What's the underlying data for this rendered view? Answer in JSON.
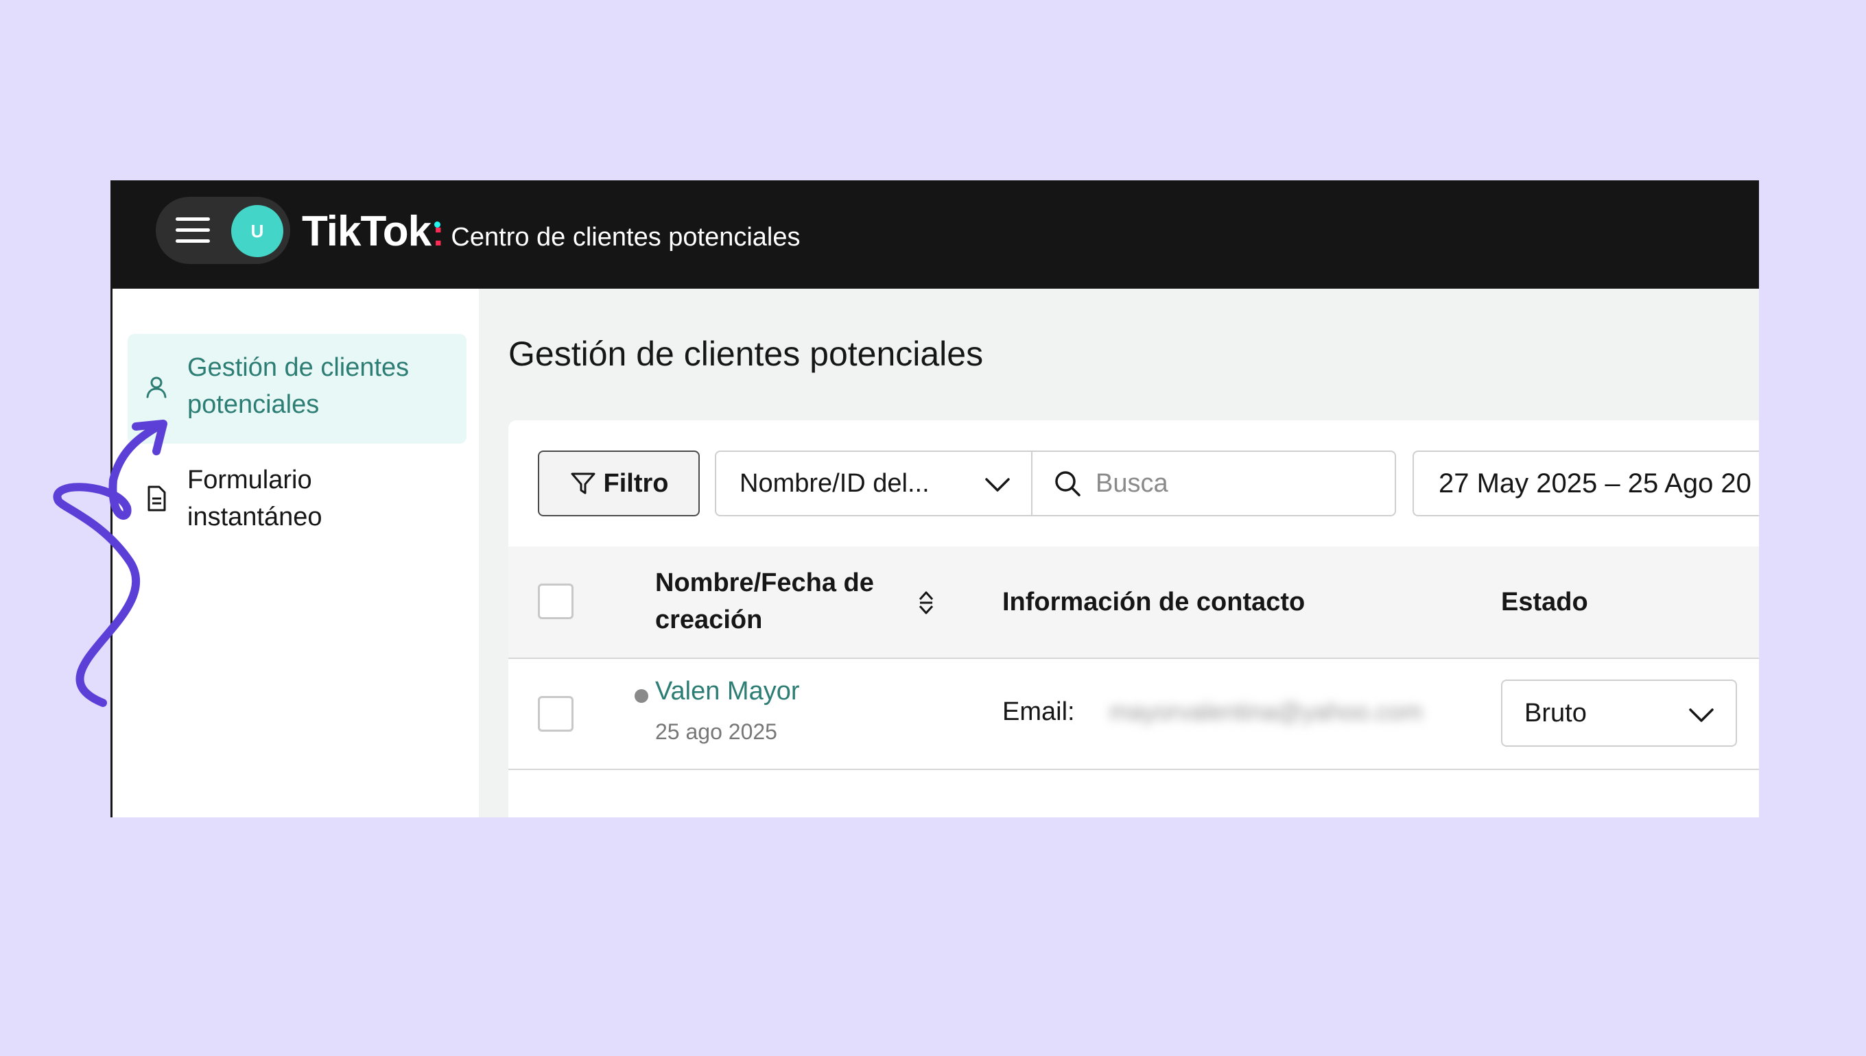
{
  "header": {
    "avatar_initial": "U",
    "brand_logo": "TikTok",
    "brand_colon": ":",
    "brand_subtitle": "Centro de clientes potenciales"
  },
  "sidebar": {
    "items": [
      {
        "label": "Gestión de clientes potenciales",
        "icon": "user-icon",
        "active": true
      },
      {
        "label": "Formulario instantáneo",
        "icon": "document-icon",
        "active": false
      }
    ]
  },
  "main": {
    "title": "Gestión de clientes potenciales",
    "toolbar": {
      "filter_label": "Filtro",
      "select_value": "Nombre/ID del...",
      "search_placeholder": "Busca",
      "date_range": "27 May 2025 – 25 Ago 20"
    },
    "table": {
      "headers": [
        "Nombre/Fecha de creación",
        "Información de contacto",
        "Estado"
      ],
      "rows": [
        {
          "name": "Valen Mayor",
          "date": "25 ago 2025",
          "email_label": "Email:",
          "email_value": "mayorvalentina@yahoo.com",
          "status": "Bruto"
        }
      ]
    }
  },
  "colors": {
    "background": "#e3ddfd",
    "topbar": "#151515",
    "accent_teal": "#2c7d74",
    "avatar": "#43d6c8",
    "annotation_arrow": "#5b3fd6"
  }
}
